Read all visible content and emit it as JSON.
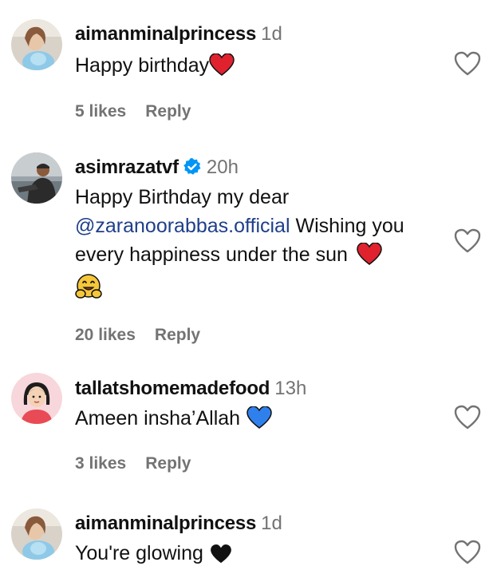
{
  "comments": [
    {
      "username": "aimanminalprincess",
      "time": "1d",
      "text": "Happy birthday",
      "likes": "5 likes",
      "reply": "Reply"
    },
    {
      "username": "asimrazatvf",
      "verified": true,
      "time": "20h",
      "text_before": "Happy Birthday my dear",
      "mention": "@zaranoorabbas.official",
      "text_after": "Wishing you every happiness under the sun",
      "likes": "20 likes",
      "reply": "Reply"
    },
    {
      "username": "tallatshomemadefood",
      "time": "13h",
      "text": "Ameen insha’Allah",
      "likes": "3 likes",
      "reply": "Reply"
    },
    {
      "username": "aimanminalprincess",
      "time": "1d",
      "text": "You're glowing"
    }
  ],
  "icons": {
    "like": "heart-outline-icon",
    "verified": "verified-badge-icon",
    "red_heart": "red-heart-emoji",
    "blue_heart": "blue-heart-emoji",
    "black_heart": "black-heart-emoji",
    "hug": "hugging-face-emoji"
  },
  "colors": {
    "text": "#111111",
    "muted": "#737373",
    "mention": "#1e3f8a",
    "verified": "#0095f6",
    "red_heart": "#e0222f",
    "blue_heart": "#2f80ed"
  }
}
